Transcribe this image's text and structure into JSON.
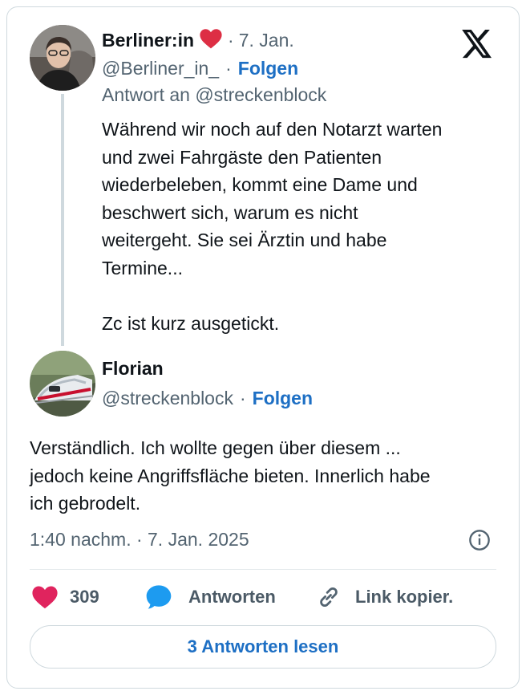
{
  "tweet_parent": {
    "author_name": "Berliner:in",
    "date": "7. Jan.",
    "handle": "@Berliner_in_",
    "follow_label": "Folgen",
    "reply_to": "Antwort an @streckenblock",
    "text": "Während wir noch auf den Notarzt warten\nund zwei Fahrgäste den Patienten\nwiederbeleben, kommt eine Dame und\nbeschwert sich, warum es nicht\nweitergeht. Sie sei Ärztin und habe\nTermine...\n\nZc ist kurz ausgetickt.",
    "separator": "·"
  },
  "tweet_main": {
    "author_name": "Florian",
    "handle": "@streckenblock",
    "follow_label": "Folgen",
    "separator": "·",
    "text": "Verständlich. Ich wollte gegen über diesem ...\njedoch keine Angriffsfläche bieten. Innerlich habe\nich gebrodelt.",
    "timestamp": "1:40 nachm. · 7. Jan. 2025"
  },
  "actions": {
    "like_count": "309",
    "reply_label": "Antworten",
    "copy_link_label": "Link kopier."
  },
  "read_replies_label": "3 Antworten lesen",
  "colors": {
    "link_blue": "#1d6fc4",
    "heart_red": "#e0245e",
    "muted_text": "#536471"
  },
  "icons": {
    "brand": "x-logo-icon",
    "heart": "heart-icon",
    "like": "like-heart-icon",
    "reply": "speech-bubble-icon",
    "link": "link-chain-icon",
    "info": "info-icon"
  }
}
